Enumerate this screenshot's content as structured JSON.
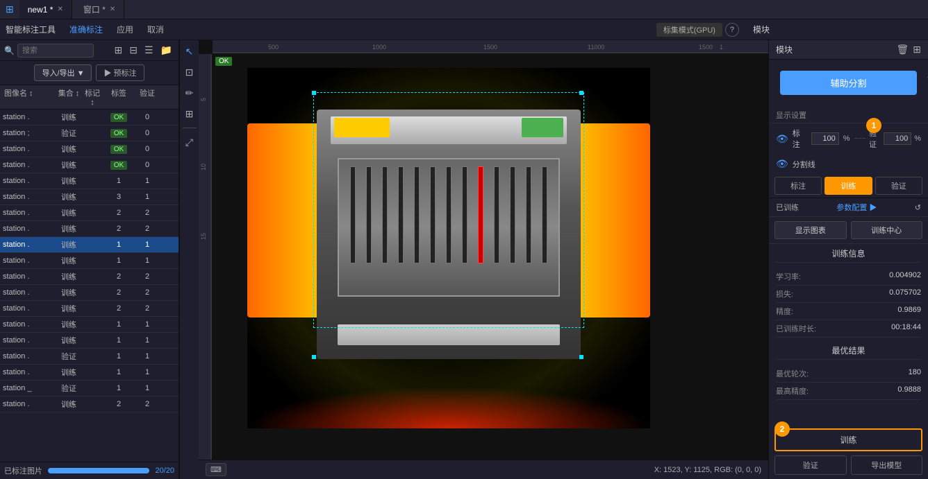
{
  "tabs": [
    {
      "label": "new1 *",
      "active": true
    },
    {
      "label": "窗口 *",
      "active": false
    }
  ],
  "toolbar": {
    "tool_label": "智能标注工具",
    "save_btn": "准确标注",
    "apply_btn": "应用",
    "cancel_btn": "取消",
    "mode_btn": "标集模式(GPU)",
    "help_btn": "?",
    "module_label": "模块"
  },
  "search": {
    "placeholder": "搜索"
  },
  "import_export_btn": "导入/导出 ▼",
  "label_btn": "▶ 预标注",
  "table": {
    "headers": [
      "图像名 ↕",
      "集合 ↕",
      "标记 ↕",
      "标签",
      "验证"
    ],
    "rows": [
      {
        "name": "station .",
        "set": "训练",
        "mark": "",
        "label": "OK",
        "verify": "0"
      },
      {
        "name": "station ;",
        "set": "验证",
        "mark": "",
        "label": "OK",
        "verify": "0"
      },
      {
        "name": "station .",
        "set": "训练",
        "mark": "",
        "label": "OK",
        "verify": "0"
      },
      {
        "name": "station .",
        "set": "训练",
        "mark": "",
        "label": "OK",
        "verify": "0"
      },
      {
        "name": "station .",
        "set": "训练",
        "mark": "",
        "label": "",
        "verify": "1",
        "v2": "1"
      },
      {
        "name": "station .",
        "set": "训练",
        "mark": "",
        "label": "",
        "verify": "3",
        "v2": "1"
      },
      {
        "name": "station .",
        "set": "训练",
        "mark": "",
        "label": "",
        "verify": "2",
        "v2": "2"
      },
      {
        "name": "station .",
        "set": "训练",
        "mark": "",
        "label": "",
        "verify": "2",
        "v2": "2"
      },
      {
        "name": "station .",
        "set": "训练",
        "mark": "",
        "label": "",
        "verify": "1",
        "v2": "1",
        "selected": true
      },
      {
        "name": "station .",
        "set": "训练",
        "mark": "",
        "label": "",
        "verify": "1",
        "v2": "1"
      },
      {
        "name": "station .",
        "set": "训练",
        "mark": "",
        "label": "",
        "verify": "2",
        "v2": "2"
      },
      {
        "name": "station .",
        "set": "训练",
        "mark": "",
        "label": "",
        "verify": "2",
        "v2": "2"
      },
      {
        "name": "station .",
        "set": "训练",
        "mark": "",
        "label": "",
        "verify": "2",
        "v2": "2"
      },
      {
        "name": "station .",
        "set": "训练",
        "mark": "",
        "label": "",
        "verify": "1",
        "v2": "1"
      },
      {
        "name": "station .",
        "set": "训练",
        "mark": "",
        "label": "",
        "verify": "1",
        "v2": "1"
      },
      {
        "name": "station .",
        "set": "验证",
        "mark": "",
        "label": "",
        "verify": "1",
        "v2": "1"
      },
      {
        "name": "station .",
        "set": "训练",
        "mark": "",
        "label": "",
        "verify": "1",
        "v2": "1"
      },
      {
        "name": "station _",
        "set": "验证",
        "mark": "",
        "label": "",
        "verify": "1",
        "v2": "1"
      },
      {
        "name": "station .",
        "set": "训练",
        "mark": "",
        "label": "",
        "verify": "2",
        "v2": "2"
      }
    ]
  },
  "footer": {
    "already_label": "已标注图片",
    "progress": "20/20",
    "progress_pct": 100
  },
  "canvas": {
    "status": "X: 1523, Y: 1125, RGB: (0, 0, 0)"
  },
  "right_panel": {
    "title": "模块",
    "train_btn": "辅助分割",
    "check": "✓",
    "display_section": "显示设置",
    "label_pct_label": "标注",
    "label_pct": "100",
    "pct_sym": "%",
    "verify_label": "验证",
    "verify_pct": "100",
    "split_label": "分割线",
    "tabs": [
      "标注",
      "训练",
      "验证"
    ],
    "active_tab": "训练",
    "trained_label": "已训练",
    "param_label": "参数配置 ▶",
    "display_graph_btn": "显示图表",
    "train_center_btn": "训练中心",
    "train_info_title": "训练信息",
    "lr_label": "学习率:",
    "lr_value": "0.004902",
    "loss_label": "损失:",
    "loss_value": "0.075702",
    "acc_label": "精度:",
    "acc_value": "0.9869",
    "trained_time_label": "已训练时长:",
    "trained_time_value": "00:18:44",
    "best_title": "最优结果",
    "best_epoch_label": "最优轮次:",
    "best_epoch_value": "180",
    "best_acc_label": "最高精度:",
    "best_acc_value": "0.9888",
    "bottom_train_btn": "训练",
    "bottom_verify_btn": "验证",
    "bottom_export_btn": "导出模型",
    "circle1_num": "1",
    "circle2_num": "2"
  }
}
